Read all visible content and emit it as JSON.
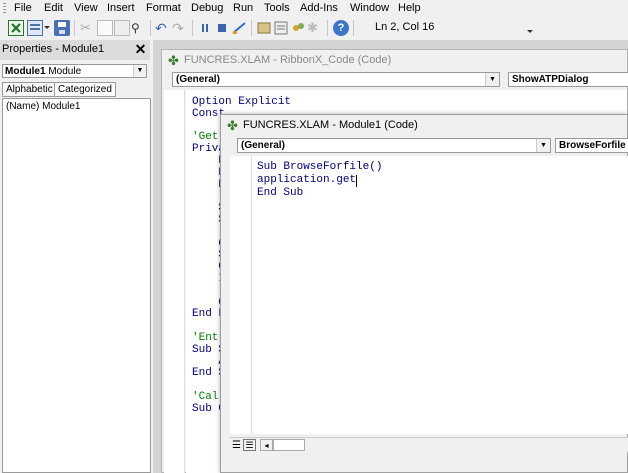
{
  "menu": [
    "File",
    "Edit",
    "View",
    "Insert",
    "Format",
    "Debug",
    "Run",
    "Tools",
    "Add-Ins",
    "Window",
    "Help"
  ],
  "toolbar": {
    "position_label": "Ln 2, Col 16"
  },
  "properties": {
    "title": "Properties - Module1",
    "close_glyph": "✕",
    "object_name": "Module1",
    "object_type": "Module",
    "tabs": [
      "Alphabetic",
      "Categorized"
    ],
    "row_name": "(Name)",
    "row_value": "Module1"
  },
  "code_window_back": {
    "title": "FUNCRES.XLAM - RibbonX_Code (Code)",
    "object_combo": "(General)",
    "proc_combo": "ShowATPDialog",
    "lines": [
      "Option Explicit",
      "Const",
      "",
      "'Get",
      "Priva",
      "    D",
      "    D",
      "    D",
      "",
      "    S",
      "    S",
      "",
      "    C",
      "    S",
      "    C",
      "    I",
      "",
      "    C",
      "End F",
      "",
      "'Entr",
      "Sub S",
      "    A",
      "End S",
      "",
      "'Call",
      "Sub C"
    ]
  },
  "code_window_front": {
    "title": "FUNCRES.XLAM - Module1 (Code)",
    "object_combo": "(General)",
    "proc_combo": "BrowseForfile",
    "lines": [
      "Sub BrowseForfile()",
      "application.get",
      "End Sub"
    ]
  },
  "colors": {
    "keyword": "#00007f",
    "comment": "#007f00",
    "window_bg": "#f0f0f0"
  }
}
